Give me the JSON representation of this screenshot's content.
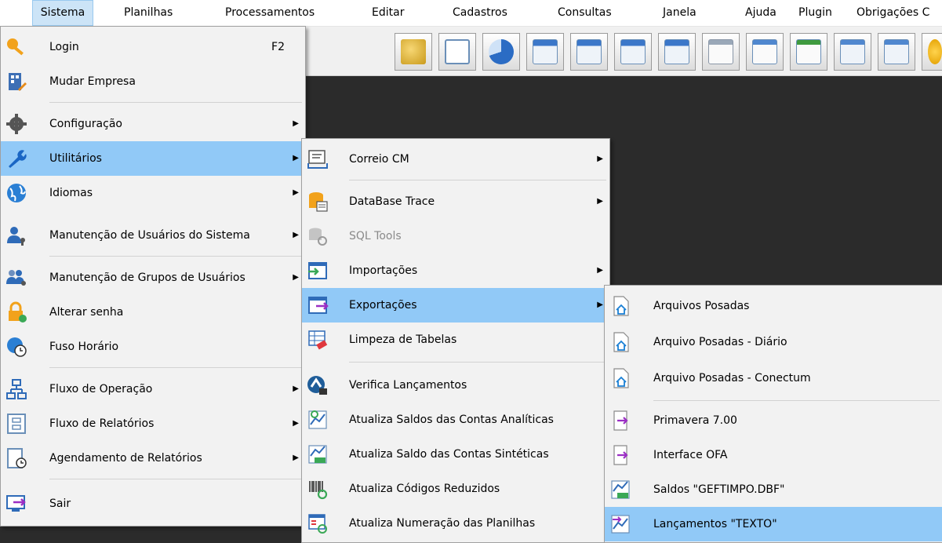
{
  "menubar": {
    "items": [
      "Sistema",
      "Planilhas",
      "Processamentos",
      "Editar",
      "Cadastros",
      "Consultas",
      "Janela",
      "Ajuda",
      "Plugin",
      "Obrigações C"
    ]
  },
  "toolbar": {
    "icons": [
      "coins-refresh-icon",
      "copy-chart-icon",
      "pie-chart-icon",
      "calendar-check-icon",
      "window-check-icon",
      "calendar-stop-icon",
      "calendar-grid-icon",
      "window-star-icon",
      "window-blank-icon",
      "window-green-icon",
      "window-lightning-icon",
      "window-add-icon",
      "sun-icon"
    ]
  },
  "menu_sistema": {
    "login": {
      "label": "Login",
      "shortcut": "F2"
    },
    "mudar_empresa": "Mudar Empresa",
    "configuracao": "Configuração",
    "utilitarios": "Utilitários",
    "idiomas": "Idiomas",
    "manut_usuarios": "Manutenção de Usuários do Sistema",
    "manut_grupos": "Manutenção de Grupos de Usuários",
    "alterar_senha": "Alterar senha",
    "fuso_horario": "Fuso Horário",
    "fluxo_operacao": "Fluxo de Operação",
    "fluxo_relatorios": "Fluxo de Relatórios",
    "agendamento": "Agendamento de Relatórios",
    "sair": "Sair"
  },
  "menu_utilitarios": {
    "correio": "Correio CM",
    "database_trace": "DataBase Trace",
    "sql_tools": "SQL Tools",
    "importacoes": "Importações",
    "exportacoes": "Exportações",
    "limpeza": "Limpeza de Tabelas",
    "verifica": "Verifica Lançamentos",
    "atualiza_analiticas": "Atualiza Saldos das Contas Analíticas",
    "atualiza_sinteticas": "Atualiza Saldo das Contas Sintéticas",
    "atualiza_codigos": "Atualiza Códigos Reduzidos",
    "atualiza_numeracao": "Atualiza Numeração das Planilhas"
  },
  "menu_exportacoes": {
    "arquivos_posadas": "Arquivos Posadas",
    "posadas_diario": "Arquivo Posadas - Diário",
    "posadas_conectum": "Arquivo Posadas - Conectum",
    "primavera": "Primavera 7.00",
    "interface_ofa": "Interface OFA",
    "saldos_geftimpo": "Saldos  \"GEFTIMPO.DBF\"",
    "lancamentos_texto": "Lançamentos \"TEXTO\""
  },
  "colors": {
    "highlight": "#91c9f7",
    "menubar_active": "#cce4f7",
    "workspace": "#2b2b2b"
  }
}
